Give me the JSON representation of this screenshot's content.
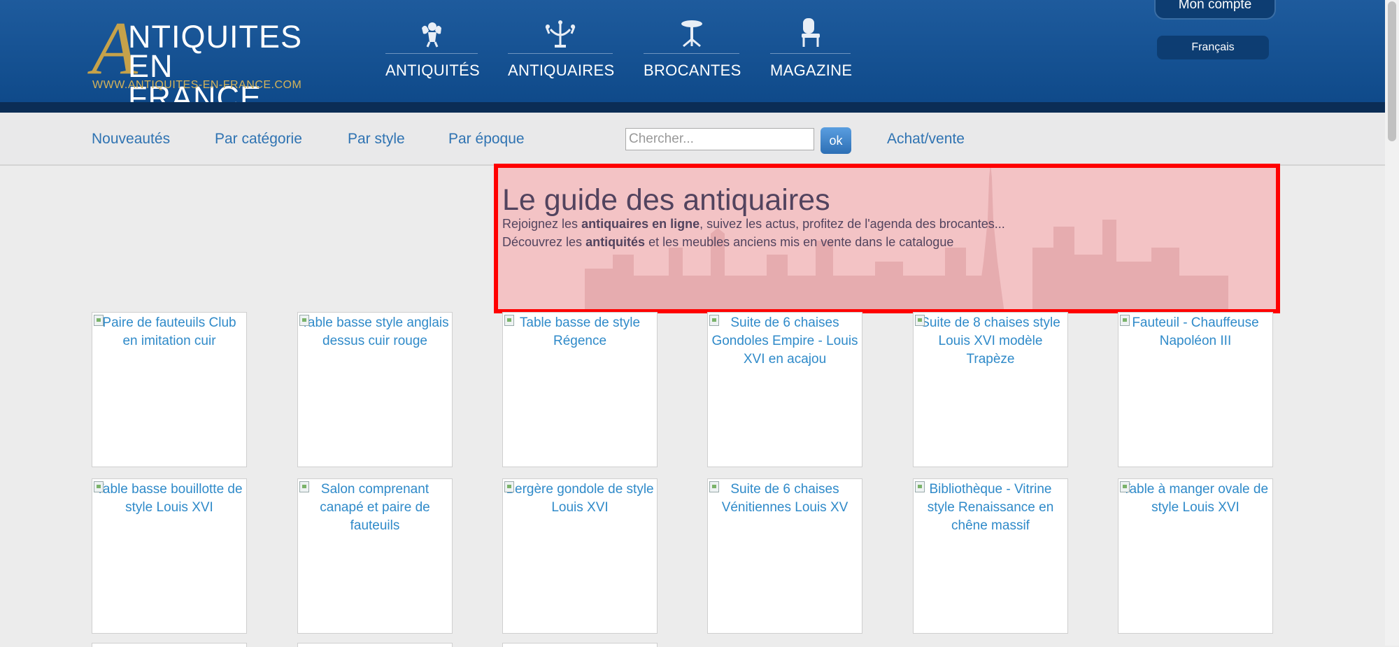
{
  "logo": {
    "line1": "NTIQUITES",
    "line2": "EN FRANCE",
    "initial": "A",
    "url": "WWW.ANTIQUITES-EN-FRANCE.COM"
  },
  "main_nav": [
    {
      "label": "ANTIQUITÉS",
      "icon": "cherub-icon"
    },
    {
      "label": "ANTIQUAIRES",
      "icon": "candelabra-icon"
    },
    {
      "label": "BROCANTES",
      "icon": "pedestal-table-icon"
    },
    {
      "label": "MAGAZINE",
      "icon": "chair-icon"
    }
  ],
  "account": {
    "label": "Mon compte"
  },
  "language": {
    "label": "Français"
  },
  "sub_nav": {
    "items": [
      "Nouveautés",
      "Par catégorie",
      "Par style",
      "Par époque"
    ],
    "search_placeholder": "Chercher...",
    "ok_label": "ok",
    "achat_vente": "Achat/vente"
  },
  "hero": {
    "title": "Le guide des antiquaires",
    "line1_pre": "Rejoignez les ",
    "line1_bold": "antiquaires en ligne",
    "line1_post": ", suivez les actus, profitez de l'agenda des brocantes...",
    "line2_pre": "Découvrez les ",
    "line2_bold": "antiquités",
    "line2_post": " et les meubles anciens mis en vente dans le catalogue"
  },
  "products": [
    "Paire de fauteuils Club en imitation cuir",
    "Table basse style anglais dessus cuir rouge",
    "Table basse de style Régence",
    "Suite de 6 chaises Gondoles Empire - Louis XVI en acajou",
    "Suite de 8 chaises style Louis XVI modèle Trapèze",
    "Fauteuil - Chauffeuse Napoléon III",
    "Table basse bouillotte de style Louis XVI",
    "Salon comprenant canapé et paire de fauteuils",
    "Bergère gondole de style Louis XVI",
    "Suite de 6 chaises Vénitiennes Louis XV",
    "Bibliothèque - Vitrine style Renaissance en chêne massif",
    "Table à manger ovale de style Louis XVI"
  ],
  "colors": {
    "header_blue": "#1e5b9d",
    "gold": "#c6a24a",
    "link_blue": "#2f8ac9",
    "highlight": "#ff0000"
  }
}
